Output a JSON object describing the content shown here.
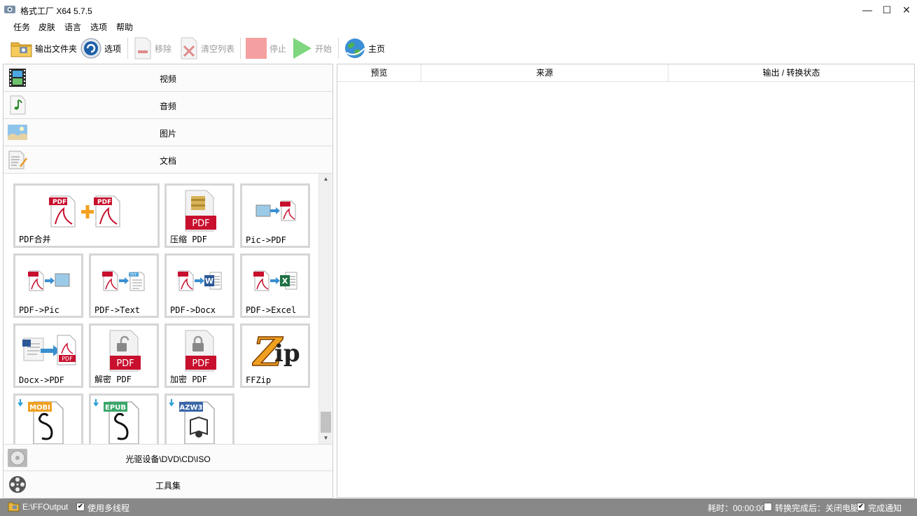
{
  "window": {
    "title": "格式工厂 X64 5.7.5",
    "minimize": "—",
    "maximize": "☐",
    "close": "✕"
  },
  "menu": [
    "任务",
    "皮肤",
    "语言",
    "选项",
    "帮助"
  ],
  "toolbar": {
    "output_folder": "输出文件夹",
    "options": "选项",
    "remove": "移除",
    "clear_list": "清空列表",
    "stop": "停止",
    "start": "开始",
    "home": "主页"
  },
  "categories": {
    "video": "视频",
    "audio": "音频",
    "picture": "图片",
    "document": "文档",
    "optical": "光驱设备\\DVD\\CD\\ISO",
    "tools": "工具集"
  },
  "tiles": [
    {
      "label": "PDF合并"
    },
    {
      "label": "压缩 PDF"
    },
    {
      "label": "Pic->PDF"
    },
    {
      "label": "PDF->Pic"
    },
    {
      "label": "PDF->Text"
    },
    {
      "label": "PDF->Docx"
    },
    {
      "label": "PDF->Excel"
    },
    {
      "label": "Docx->PDF"
    },
    {
      "label": "解密 PDF"
    },
    {
      "label": "加密 PDF"
    },
    {
      "label": "FFZip"
    },
    {
      "label": "",
      "badge": "MOBI"
    },
    {
      "label": "",
      "badge": "EPUB"
    },
    {
      "label": "",
      "badge": "AZW3"
    }
  ],
  "icon_text": {
    "pdf_tag": "PDF",
    "pdf_big": "PDF",
    "txt_tag": "TXT",
    "word_letter": "W",
    "excel_letter": "X",
    "zip_z": "Z",
    "zip_ip": "ip"
  },
  "file_list": {
    "columns": [
      "预览",
      "来源",
      "输出 / 转换状态"
    ]
  },
  "status": {
    "output_path": "E:\\FFOutput",
    "multithread": "使用多线程",
    "multithread_checked": "✔",
    "elapsed": "耗时：00:00:00",
    "after_convert": "转换完成后：关闭电脑",
    "notify": "完成通知",
    "notify_checked": "✔"
  },
  "colors": {
    "status_bg": "#888888",
    "pdf_red": "#c8102e",
    "tile_border": "#d6d6d6",
    "stop_red": "#f4a0a0",
    "start_green": "#7ed67e"
  }
}
